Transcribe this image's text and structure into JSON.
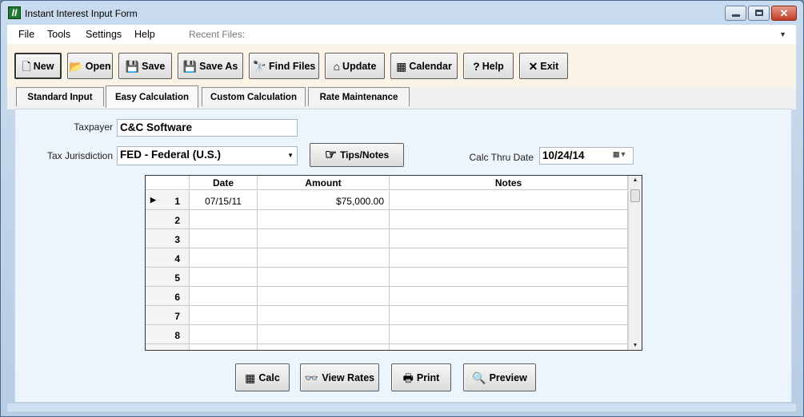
{
  "window": {
    "title": "Instant Interest Input Form",
    "icon_letter": "II"
  },
  "menu": {
    "items": [
      "File",
      "Tools",
      "Settings",
      "Help"
    ],
    "recent_label": "Recent Files:",
    "recent_value": ""
  },
  "toolbar": {
    "new": "New",
    "open": "Open",
    "save": "Save",
    "save_as": "Save As",
    "find_files": "Find Files",
    "update": "Update",
    "calendar": "Calendar",
    "help": "Help",
    "exit": "Exit"
  },
  "tabs": [
    "Standard Input",
    "Easy Calculation",
    "Custom Calculation",
    "Rate Maintenance"
  ],
  "selected_tab": "Easy Calculation",
  "form": {
    "taxpayer_label": "Taxpayer",
    "taxpayer_value": "C&C Software",
    "jurisdiction_label": "Tax Jurisdiction",
    "jurisdiction_value": "FED - Federal (U.S.)",
    "tips_label": "Tips/Notes",
    "calc_thru_label": "Calc Thru Date",
    "calc_thru_value": "10/24/14"
  },
  "grid": {
    "columns": [
      "Date",
      "Amount",
      "Notes"
    ],
    "rows": [
      {
        "num": "1",
        "date": "07/15/11",
        "amount": "$75,000.00",
        "notes": ""
      },
      {
        "num": "2",
        "date": "",
        "amount": "",
        "notes": ""
      },
      {
        "num": "3",
        "date": "",
        "amount": "",
        "notes": ""
      },
      {
        "num": "4",
        "date": "",
        "amount": "",
        "notes": ""
      },
      {
        "num": "5",
        "date": "",
        "amount": "",
        "notes": ""
      },
      {
        "num": "6",
        "date": "",
        "amount": "",
        "notes": ""
      },
      {
        "num": "7",
        "date": "",
        "amount": "",
        "notes": ""
      },
      {
        "num": "8",
        "date": "",
        "amount": "",
        "notes": ""
      }
    ]
  },
  "actions": {
    "calc": "Calc",
    "view_rates": "View Rates",
    "print": "Print",
    "preview": "Preview"
  },
  "colors": {
    "panel": "#edf5fc",
    "toolbar": "#fbf3e6",
    "window": "#c9dbee"
  }
}
